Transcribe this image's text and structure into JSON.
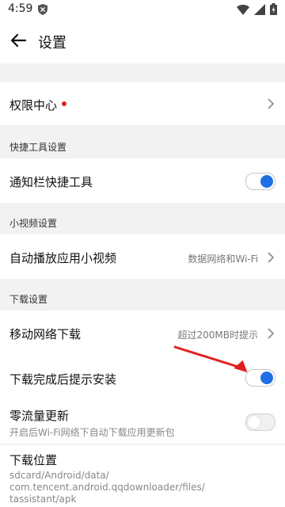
{
  "status": {
    "time": "4:59"
  },
  "header": {
    "title": "设置"
  },
  "rows": {
    "permission_center": "权限中心",
    "notif_tools": "通知栏快捷工具",
    "autoplay_label": "自动播放应用小视频",
    "autoplay_value": "数据网络和Wi-Fi",
    "mobile_download_label": "移动网络下载",
    "mobile_download_value": "超过200MB时提示",
    "install_prompt_label": "下载完成后提示安装",
    "zero_traffic_label": "零流量更新",
    "zero_traffic_sub": "开启后Wi-Fi网络下自动下载应用更新包",
    "download_location_label": "下载位置",
    "download_location_path_1": "sdcard/Android/data/",
    "download_location_path_2": "com.tencent.android.qqdownloader/files/",
    "download_location_path_3": "tassistant/apk"
  },
  "sections": {
    "quick_tools": "快捷工具设置",
    "mini_video": "小视频设置",
    "download": "下载设置"
  },
  "toggles": {
    "notif_tools_on": true,
    "install_prompt_on": true,
    "zero_traffic_on": false
  },
  "colors": {
    "accent": "#1f6fe5",
    "badge": "#e02020",
    "annotation_arrow": "#e02020"
  }
}
